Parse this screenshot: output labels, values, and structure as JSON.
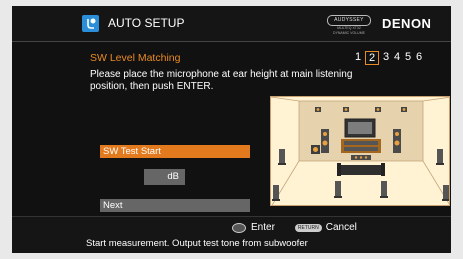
{
  "header": {
    "title": "AUTO SETUP",
    "audyssey_badge": "AUDYSSEY",
    "audyssey_sub_lines": [
      "MULTEQ XT32",
      "DYNAMIC VOLUME"
    ],
    "brand": "DENON"
  },
  "section": {
    "title": "SW Level Matching",
    "steps": [
      {
        "label": "1"
      },
      {
        "label": "2",
        "current": true
      },
      {
        "label": "3"
      },
      {
        "label": "4"
      },
      {
        "label": "5"
      },
      {
        "label": "6"
      }
    ],
    "instruction": "Please place the microphone at ear height at main listening position, then push ENTER."
  },
  "controls": {
    "sw_test_start_label": "SW Test Start",
    "db_unit": "dB",
    "next_label": "Next"
  },
  "footer": {
    "enter_label": "Enter",
    "return_badge": "RETURN",
    "cancel_label": "Cancel",
    "status_message": "Start measurement. Output test tone from subwoofer"
  },
  "colors": {
    "accent": "#e47a1e",
    "header_icon": "#2a8fd8",
    "room_background": "#fff3d4"
  }
}
